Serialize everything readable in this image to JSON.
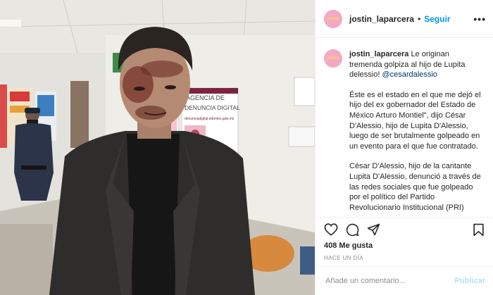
{
  "post": {
    "username": "jostin_laparcera",
    "follow_label": "Seguir",
    "more_label": "•••",
    "avatar_text": "jostin",
    "caption_username": "jostin_laparcera",
    "caption_line1": "Le originan tremenda golpiza al hijo de Lupita delessio!",
    "caption_mention": "@cesardalessio",
    "paragraph2": "Éste es el estado en el que me dejó el hijo del ex gobernador del Estado de México Arturo Montiel\", dijo César D'Alessio, hijo de Lupita D'Alessio, luego de ser brutalmente golpeado en un evento para el que fue contratado.",
    "paragraph3": "César D'Alessio, hijo de la cantante Lupita D'Alessio, denunció a través de las redes sociales que fue golpeado por el político del Partido Revolucionario Institucional (PRI)",
    "likes": "408 Me gusta",
    "time_ago": "HACE UN DÍA",
    "comment_placeholder": "Añade un comentario...",
    "publish_label": "Publicar"
  },
  "photo": {
    "sign_line1": "AGENCIA DE",
    "sign_line2": "DENUNCIA DIGITAL",
    "sign_url": "denunciadigital.edomex.gob.mx"
  },
  "icons": {
    "like": "heart-icon",
    "comment": "comment-bubble-icon",
    "share": "paper-plane-icon",
    "save": "bookmark-icon"
  },
  "colors": {
    "link": "#0095f6",
    "mention": "#00376b",
    "avatar_bg": "#f4a8c6",
    "publish_disabled": "#b2dffc"
  }
}
